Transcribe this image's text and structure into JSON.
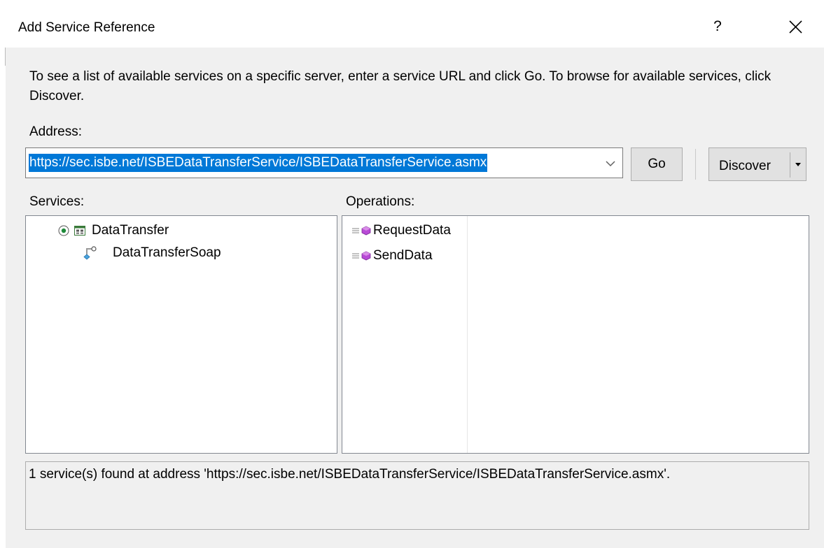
{
  "window": {
    "title": "Add Service Reference",
    "help_label": "?",
    "close_icon": "close-icon"
  },
  "instructions": "To see a list of available services on a specific server, enter a service URL and click Go. To browse for available services, click Discover.",
  "address": {
    "label": "Address:",
    "value": "https://sec.isbe.net/ISBEDataTransferService/ISBEDataTransferService.asmx",
    "dropdown_icon": "chevron-down-icon"
  },
  "buttons": {
    "go_label": "Go",
    "discover_label": "Discover",
    "discover_dropdown_icon": "caret-down-icon"
  },
  "services": {
    "label": "Services:",
    "items": [
      {
        "label": "DataTransfer",
        "icon": "service-icon",
        "expanded": true
      },
      {
        "label": "DataTransferSoap",
        "icon": "endpoint-icon"
      }
    ]
  },
  "operations": {
    "label": "Operations:",
    "items": [
      {
        "label": "RequestData",
        "icon": "method-icon"
      },
      {
        "label": "SendData",
        "icon": "method-icon"
      }
    ]
  },
  "status": {
    "text": "1 service(s) found at address 'https://sec.isbe.net/ISBEDataTransferService/ISBEDataTransferService.asmx'."
  },
  "colors": {
    "selection": "#0078d7",
    "method_icon": "#b84ad6",
    "background": "#f0f0f0"
  }
}
